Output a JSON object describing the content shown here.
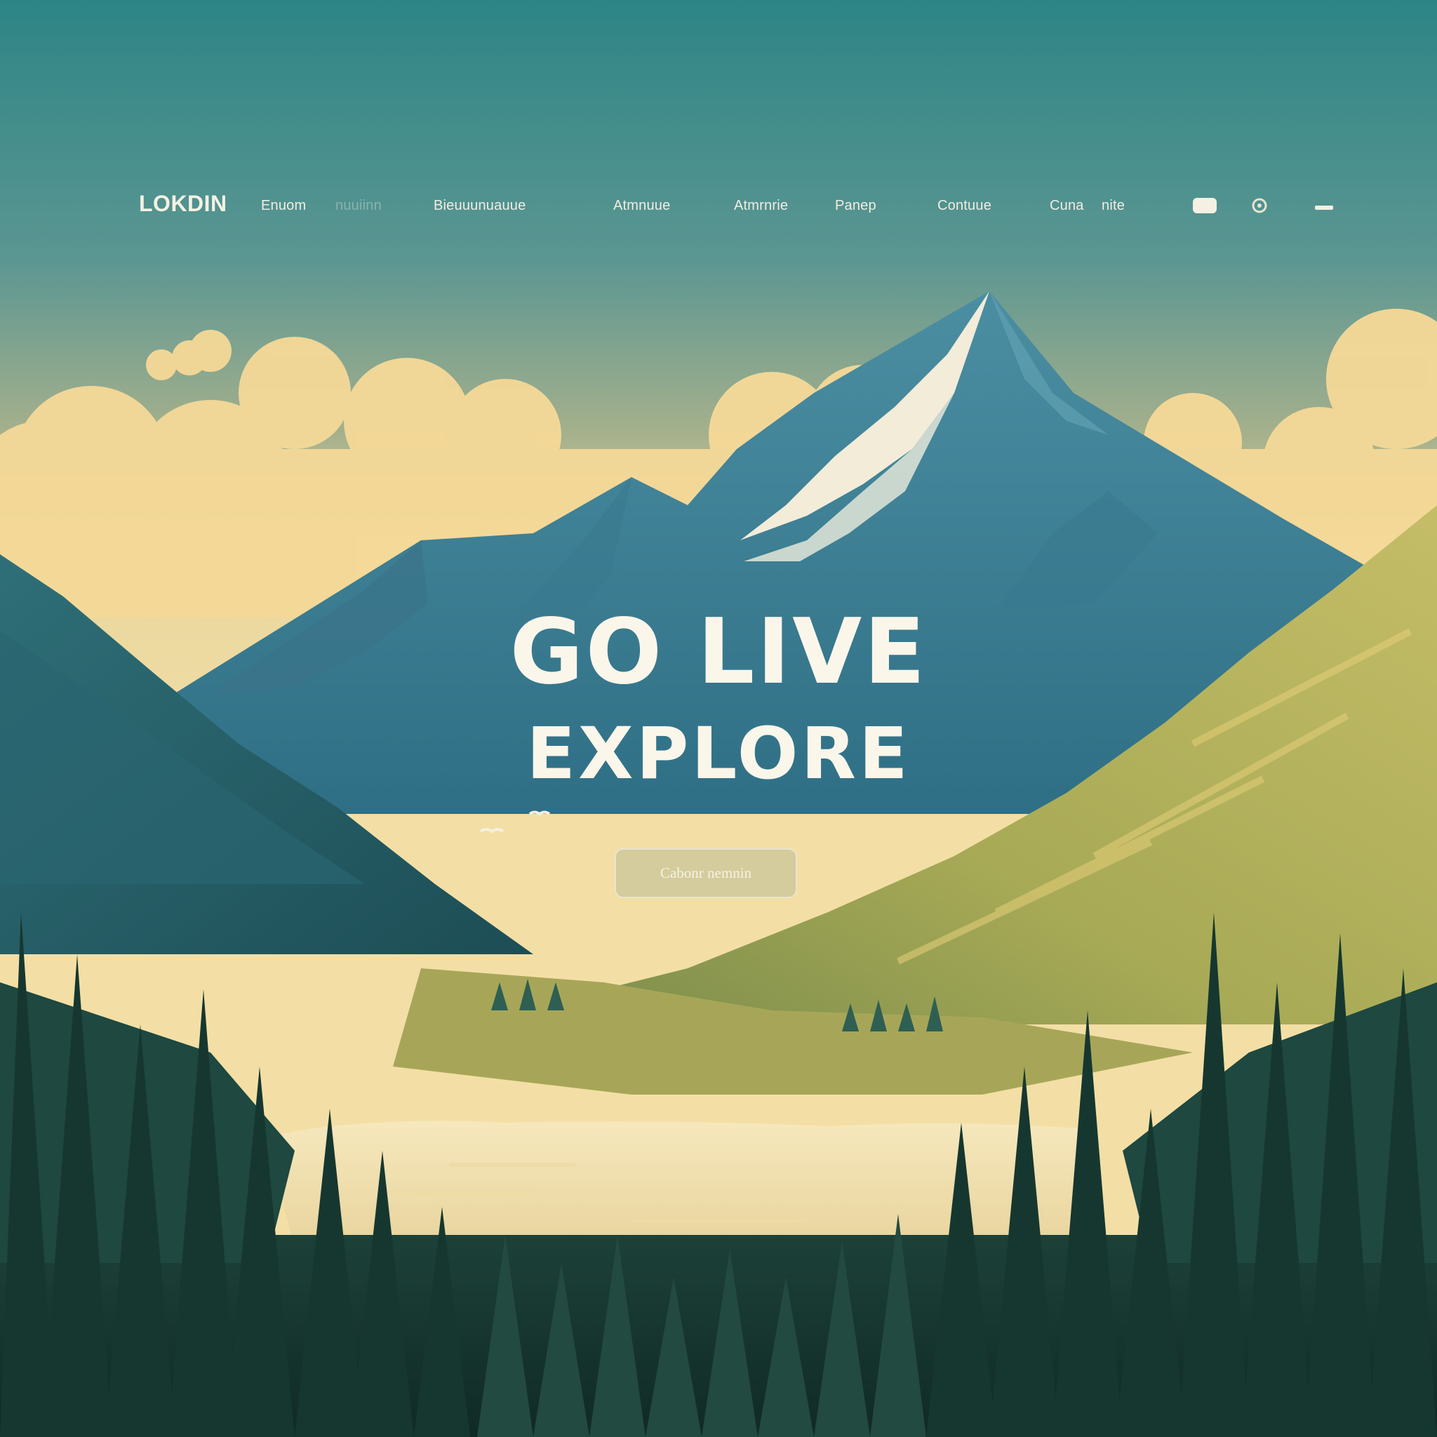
{
  "nav": {
    "logo": "LOKDIN",
    "links": [
      {
        "label": "Enuom",
        "faded": false
      },
      {
        "label": "nuuiinn",
        "faded": true
      },
      {
        "label": "Bieuuunuauue",
        "faded": false
      },
      {
        "label": "Atmnuue",
        "faded": false
      },
      {
        "label": "Atmrnrie",
        "faded": false
      },
      {
        "label": "Panep",
        "faded": false
      },
      {
        "label": "Contuue",
        "faded": false
      },
      {
        "label": "Cuna",
        "faded": false
      },
      {
        "label": "nite",
        "faded": false
      }
    ],
    "icons": [
      "toggle-icon",
      "settings-icon",
      "menu-icon"
    ]
  },
  "hero": {
    "title": "GO LIVE",
    "subtitle": "EXPLORE",
    "cta_label": "Cabonr nemnin"
  },
  "colors": {
    "sky_top": "#2f8686",
    "sky_mid": "#8aa98a",
    "sky_horizon": "#f2dda0",
    "cloud": "#f5d998",
    "mountain_blue": "#3f7f96",
    "mountain_snow": "#f3ecd9",
    "hill_green": "#b9b65d",
    "forest_dark": "#16372f",
    "lake": "#f3e3b3",
    "text": "#fbf6ea"
  }
}
